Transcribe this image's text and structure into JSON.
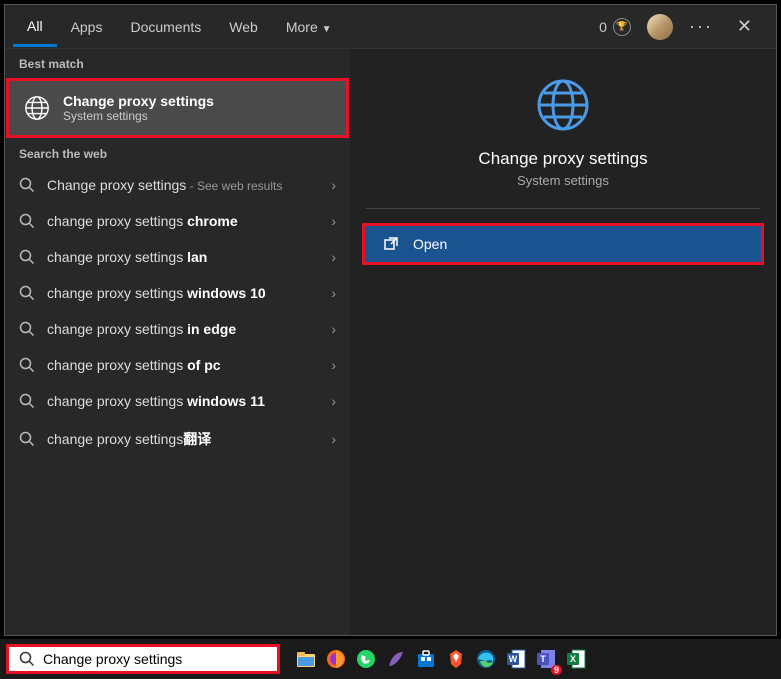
{
  "tabs": {
    "all": "All",
    "apps": "Apps",
    "documents": "Documents",
    "web": "Web",
    "more": "More"
  },
  "header": {
    "reward_count": "0"
  },
  "sections": {
    "best_match": "Best match",
    "search_web": "Search the web"
  },
  "best_match": {
    "title": "Change proxy settings",
    "subtitle": "System settings"
  },
  "web_results": [
    {
      "prefix": "Change proxy settings",
      "bold": "",
      "suffix": " - See web results"
    },
    {
      "prefix": "change proxy settings ",
      "bold": "chrome",
      "suffix": ""
    },
    {
      "prefix": "change proxy settings ",
      "bold": "lan",
      "suffix": ""
    },
    {
      "prefix": "change proxy settings ",
      "bold": "windows 10",
      "suffix": ""
    },
    {
      "prefix": "change proxy settings ",
      "bold": "in edge",
      "suffix": ""
    },
    {
      "prefix": "change proxy settings ",
      "bold": "of pc",
      "suffix": ""
    },
    {
      "prefix": "change proxy settings ",
      "bold": "windows 11",
      "suffix": ""
    },
    {
      "prefix": "change proxy settings",
      "bold": "翻译",
      "suffix": ""
    }
  ],
  "detail": {
    "title": "Change proxy settings",
    "subtitle": "System settings",
    "action_open": "Open"
  },
  "search_input": {
    "value": "Change proxy settings"
  },
  "colors": {
    "highlight": "#e81123",
    "accent": "#0078d4",
    "action_bg": "#1a5490"
  }
}
